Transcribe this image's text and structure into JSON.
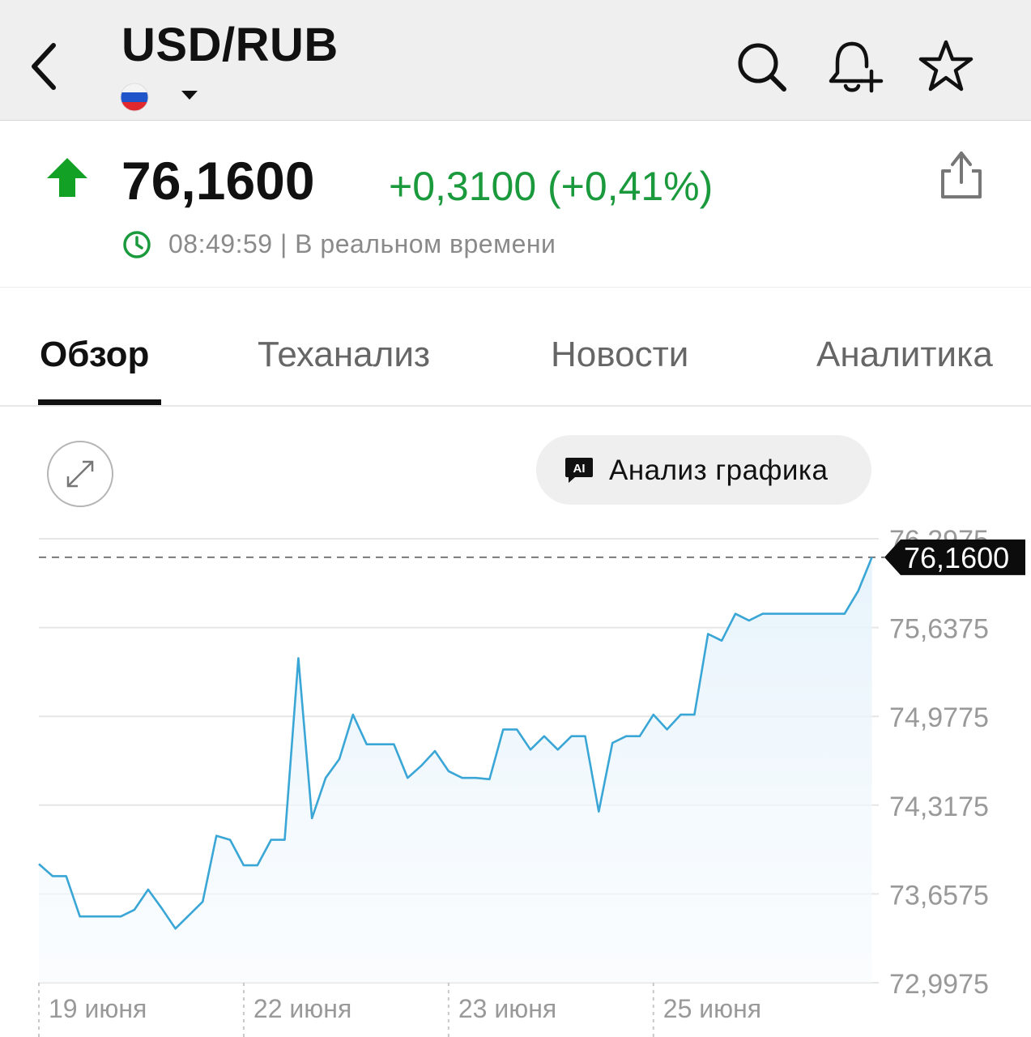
{
  "header": {
    "title": "USD/RUB",
    "icons": [
      "back-icon",
      "flag-ru-icon",
      "chevron-down-icon",
      "search-icon",
      "bell-plus-icon",
      "star-icon"
    ]
  },
  "quote": {
    "price": "76,1600",
    "change": "+0,3100 (+0,41%)",
    "time": "08:49:59 | В реальном времени",
    "colors": {
      "up": "#1a9a3c",
      "arrow": "#12a125"
    }
  },
  "tabs": [
    {
      "label": "Обзор",
      "active": true
    },
    {
      "label": "Теханализ",
      "active": false
    },
    {
      "label": "Новости",
      "active": false
    },
    {
      "label": "Аналитика",
      "active": false
    }
  ],
  "toolbar": {
    "ai_icon_text": "AI",
    "ai_button_label": "Анализ графика"
  },
  "chart_data": {
    "type": "line",
    "ylim": [
      72.9975,
      76.2975
    ],
    "yticks": [
      "76,2975",
      "75,6375",
      "74,9775",
      "74,3175",
      "73,6575",
      "72,9975"
    ],
    "ytick_values": [
      76.2975,
      75.6375,
      74.9775,
      74.3175,
      73.6575,
      72.9975
    ],
    "xticks": [
      "19 июня",
      "22 июня",
      "23 июня",
      "25 июня"
    ],
    "x_range": [
      0,
      61.5
    ],
    "xtick_positions": [
      0,
      15,
      30,
      45
    ],
    "current_value": 76.16,
    "current_label": "76,1600",
    "line_color": "#3aa6d6",
    "series": [
      {
        "x": [
          0,
          1,
          2,
          3,
          4,
          5,
          6,
          7,
          8,
          9,
          10,
          11,
          12,
          13,
          14,
          15,
          16,
          17,
          18,
          19,
          20,
          21,
          22,
          23,
          24,
          25,
          26,
          27,
          28,
          29,
          30,
          31,
          32,
          33,
          34,
          35,
          36,
          37,
          38,
          39,
          40,
          41,
          42,
          43,
          44,
          45,
          46,
          47,
          48,
          49,
          50,
          51,
          52,
          53,
          54,
          55,
          56,
          57,
          58,
          59,
          60,
          61
        ],
        "y": [
          73.88,
          73.79,
          73.79,
          73.49,
          73.49,
          73.49,
          73.49,
          73.54,
          73.69,
          73.55,
          73.4,
          73.5,
          73.6,
          74.09,
          74.06,
          73.87,
          73.87,
          74.06,
          74.06,
          75.41,
          74.22,
          74.52,
          74.66,
          74.99,
          74.77,
          74.77,
          74.77,
          74.52,
          74.61,
          74.72,
          74.57,
          74.52,
          74.52,
          74.51,
          74.88,
          74.88,
          74.73,
          74.83,
          74.73,
          74.83,
          74.83,
          74.27,
          74.78,
          74.83,
          74.83,
          74.99,
          74.88,
          74.99,
          74.99,
          75.59,
          75.54,
          75.74,
          75.69,
          75.74,
          75.74,
          75.74,
          75.74,
          75.74,
          75.74,
          75.74,
          75.91,
          76.16
        ]
      }
    ]
  }
}
